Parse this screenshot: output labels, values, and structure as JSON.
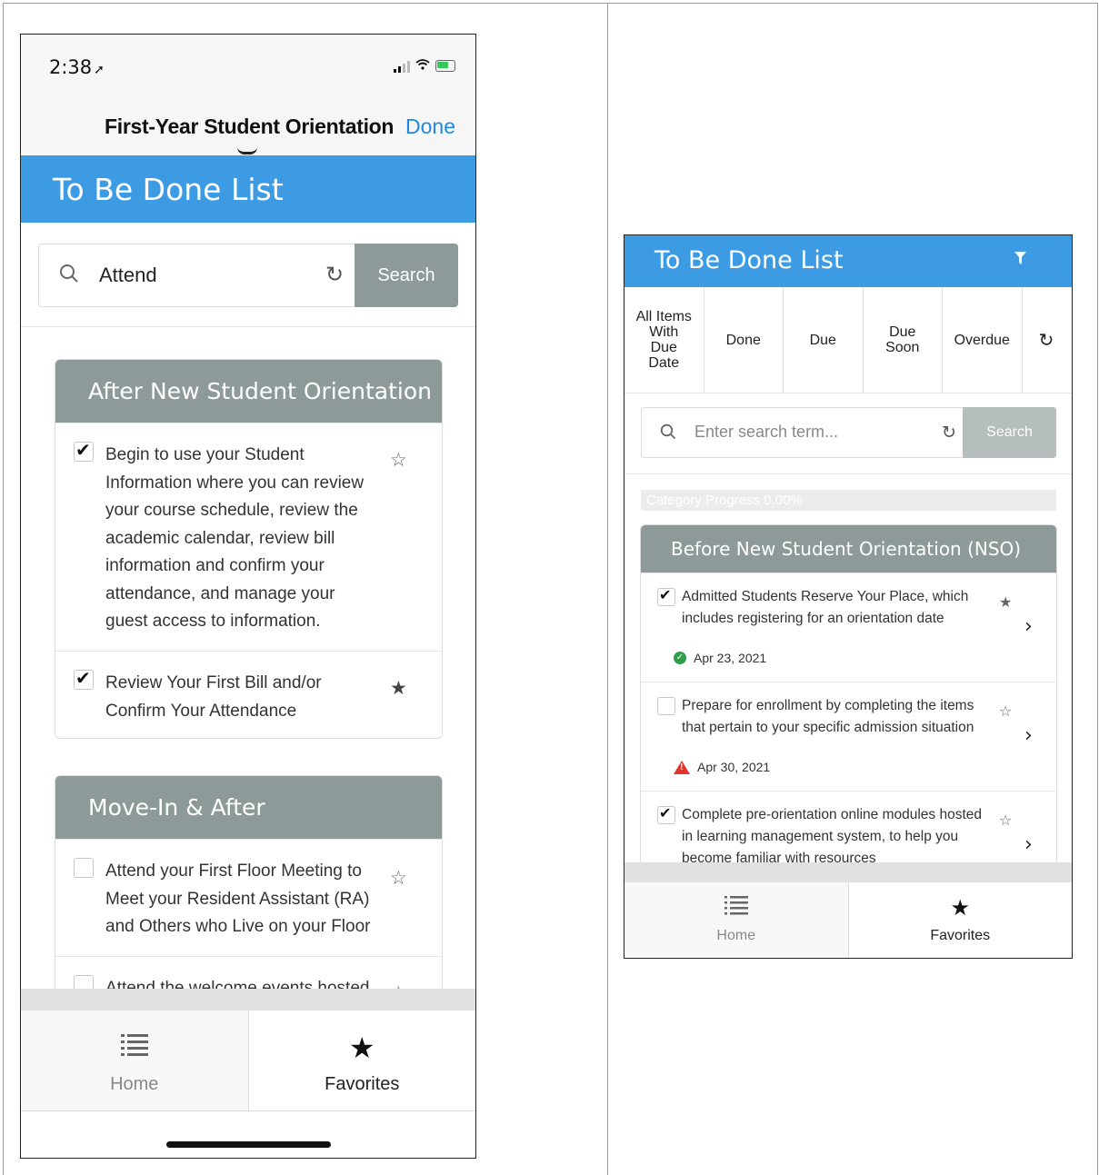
{
  "left": {
    "status": {
      "time": "2:38",
      "location_arrow": "➤"
    },
    "nav": {
      "title": "First-Year Student Orientation",
      "done": "Done"
    },
    "header": {
      "title": "To Be Done List"
    },
    "search": {
      "value": "Attend",
      "reset_glyph": "↻",
      "button": "Search"
    },
    "cards": [
      {
        "title": "After New Student Orientation",
        "items": [
          {
            "text": "Begin to use your Student Information where you can review your course schedule, review the academic calendar, review bill information and confirm your attendance, and manage your guest access to information.",
            "checked": true,
            "favorite": false
          },
          {
            "text": "Review Your First Bill and/or Confirm Your Attendance",
            "checked": true,
            "favorite": true
          }
        ]
      },
      {
        "title": "Move-In & After",
        "items": [
          {
            "text": "Attend your First Floor Meeting to Meet your Resident Assistant (RA) and Others who Live on your Floor",
            "checked": false,
            "favorite": false
          },
          {
            "text": "Attend the welcome events hosted",
            "checked": false,
            "favorite": false
          }
        ]
      }
    ],
    "tabs": {
      "home": "Home",
      "favorites": "Favorites"
    }
  },
  "right": {
    "header": {
      "title": "To Be Done List"
    },
    "filters": [
      "All Items With Due Date",
      "Done",
      "Due",
      "Due Soon",
      "Overdue"
    ],
    "filter_reset_glyph": "↻",
    "search": {
      "placeholder": "Enter search term...",
      "reset_glyph": "↻",
      "button": "Search"
    },
    "progress": {
      "label": "Category Progress 0.00%",
      "percent": 0
    },
    "card": {
      "title": "Before New Student Orientation (NSO)",
      "items": [
        {
          "text": "Admitted Students Reserve Your Place, which includes registering for an orientation date",
          "checked": true,
          "favorite": true,
          "date": "Apr 23, 2021",
          "status": "done"
        },
        {
          "text": "Prepare for enrollment by completing the items that pertain to your specific admission situation",
          "checked": false,
          "favorite": false,
          "date": "Apr 30, 2021",
          "status": "overdue"
        },
        {
          "text": "Complete pre-orientation online modules hosted in learning management system, to help you become familiar with resources",
          "checked": true,
          "favorite": false,
          "date": "",
          "status": ""
        }
      ]
    },
    "tabs": {
      "home": "Home",
      "favorites": "Favorites"
    }
  },
  "icons": {
    "checkmark": "✔",
    "star_filled": "★",
    "star_empty": "☆",
    "chevron": "›",
    "list": "☰"
  },
  "colors": {
    "accent_blue": "#3d9be4",
    "header_gray": "#8e9a9a",
    "link_blue": "#1e88e5",
    "ok_green": "#2e9e4a",
    "warn_red": "#e0342d"
  }
}
